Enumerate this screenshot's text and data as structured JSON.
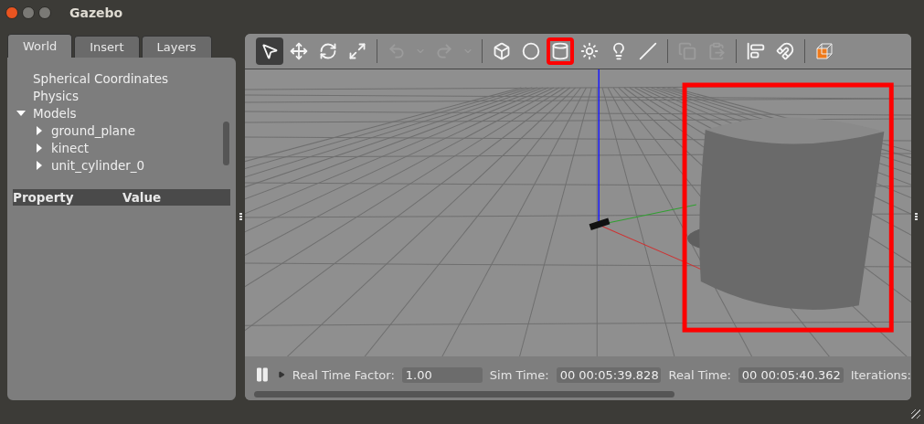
{
  "window": {
    "title": "Gazebo"
  },
  "tabs": [
    {
      "label": "World",
      "selected": true
    },
    {
      "label": "Insert",
      "selected": false
    },
    {
      "label": "Layers",
      "selected": false
    }
  ],
  "tree": [
    {
      "label": "Spherical Coordinates"
    },
    {
      "label": "Physics"
    },
    {
      "label": "Models",
      "expanded": true,
      "children": [
        {
          "label": "ground_plane",
          "expanded": false
        },
        {
          "label": "kinect",
          "expanded": false
        },
        {
          "label": "unit_cylinder_0",
          "expanded": false
        }
      ]
    }
  ],
  "property_table": {
    "columns": [
      "Property",
      "Value"
    ]
  },
  "toolbar": [
    {
      "kind": "select",
      "selected": true,
      "disabled": false,
      "highlighted": false
    },
    {
      "kind": "translate",
      "selected": false,
      "disabled": false,
      "highlighted": false
    },
    {
      "kind": "rotate",
      "selected": false,
      "disabled": false,
      "highlighted": false
    },
    {
      "kind": "scale",
      "selected": false,
      "disabled": false,
      "highlighted": false
    },
    {
      "kind": "separator"
    },
    {
      "kind": "undo",
      "selected": false,
      "disabled": true,
      "highlighted": false
    },
    {
      "kind": "caret",
      "selected": false,
      "disabled": true,
      "highlighted": false
    },
    {
      "kind": "redo",
      "selected": false,
      "disabled": true,
      "highlighted": false
    },
    {
      "kind": "caret",
      "selected": false,
      "disabled": true,
      "highlighted": false
    },
    {
      "kind": "separator"
    },
    {
      "kind": "box",
      "selected": false,
      "disabled": false,
      "highlighted": false
    },
    {
      "kind": "sphere",
      "selected": false,
      "disabled": false,
      "highlighted": false
    },
    {
      "kind": "cylinder",
      "selected": false,
      "disabled": false,
      "highlighted": true
    },
    {
      "kind": "pointlight",
      "selected": false,
      "disabled": false,
      "highlighted": false
    },
    {
      "kind": "spotlight",
      "selected": false,
      "disabled": false,
      "highlighted": false
    },
    {
      "kind": "directionallight",
      "selected": false,
      "disabled": false,
      "highlighted": false
    },
    {
      "kind": "separator"
    },
    {
      "kind": "copy",
      "selected": false,
      "disabled": true,
      "highlighted": false
    },
    {
      "kind": "paste",
      "selected": false,
      "disabled": true,
      "highlighted": false
    },
    {
      "kind": "separator"
    },
    {
      "kind": "align",
      "selected": false,
      "disabled": false,
      "highlighted": false
    },
    {
      "kind": "snap",
      "selected": false,
      "disabled": false,
      "highlighted": false
    },
    {
      "kind": "separator"
    },
    {
      "kind": "view",
      "selected": false,
      "disabled": false,
      "highlighted": false
    }
  ],
  "viewport": {
    "highlighted": true
  },
  "status_bar": {
    "real_time_factor_label": "Real Time Factor:",
    "real_time_factor": "1.00",
    "sim_time_label": "Sim Time:",
    "sim_time": "00 00:05:39.828",
    "real_time_label": "Real Time:",
    "real_time": "00 00:05:40.362",
    "iterations_label": "Iterations:"
  }
}
